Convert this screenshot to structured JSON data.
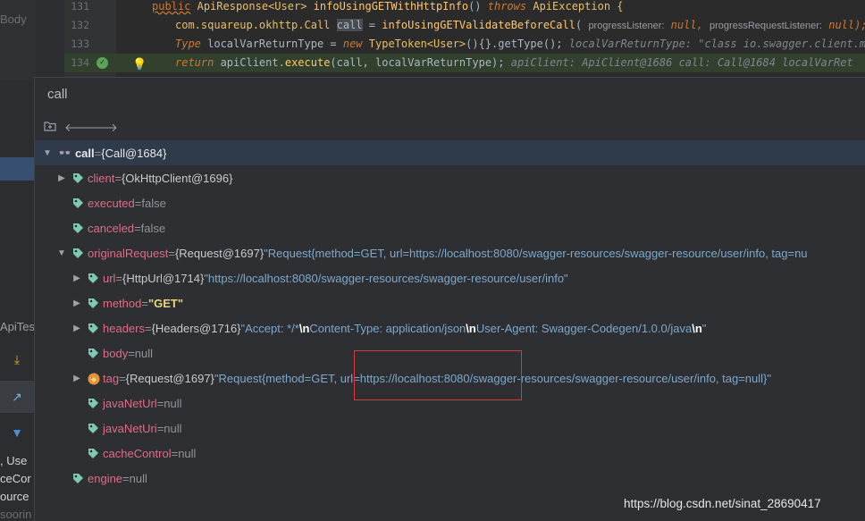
{
  "left_panel": {
    "items": [
      "Body",
      "ApiTes",
      ", Use",
      "ceCor",
      "ource",
      "soorin"
    ],
    "icons": [
      "arrow-down-icon",
      "arrow-up-right-icon",
      "filter-icon"
    ]
  },
  "editor": {
    "lines": [
      {
        "number": "131",
        "keyword_public": "public",
        "type_api": "ApiResponse",
        "type_user": "<User>",
        "method": "infoUsingGETWithHttpInfo",
        "sig_rest": "() ",
        "throws": "throws",
        "exc": "ApiException {"
      },
      {
        "number": "132",
        "prefix": "com.squareup.okhttp.Call ",
        "var": "call",
        "mid": " = ",
        "method": "infoUsingGETValidateBeforeCall",
        "paren": "(",
        "hint1_label": "progressListener:",
        "hint1_val": "null,",
        "hint2_label": "progressRequestListener:",
        "hint2_val": "null);"
      },
      {
        "number": "133",
        "type1": "Type",
        "var": " localVarReturnType = ",
        "new": "new",
        "type2": " TypeToken",
        "generic": "<User>",
        "rest": "(){}.getType();",
        "hint": "localVarReturnType: \"class io.swagger.client.mod"
      },
      {
        "number": "134",
        "return": "return",
        "body": " apiClient.",
        "method": "execute",
        "args": "(call, localVarReturnType);",
        "hint": "apiClient: ApiClient@1686  call: Call@1684  localVarRet"
      }
    ]
  },
  "popup": {
    "title": "call",
    "toolbar_icons": [
      "folder-icon",
      "back-arrow-icon",
      "forward-arrow-icon"
    ],
    "rows": [
      {
        "name": "call",
        "eq": " = ",
        "ref": "{Call@1684}"
      },
      {
        "name": "client",
        "eq": " = ",
        "ref": "{OkHttpClient@1696}"
      },
      {
        "name": "executed",
        "eq": " = ",
        "value": "false"
      },
      {
        "name": "canceled",
        "eq": " = ",
        "value": "false"
      },
      {
        "name": "originalRequest",
        "eq": " = ",
        "ref": "{Request@1697} ",
        "str": "\"Request{method=GET, url=https://localhost:8080/swagger-resources/swagger-resource/user/info, tag=nu"
      },
      {
        "name": "url",
        "eq": " = ",
        "ref": "{HttpUrl@1714} ",
        "str": "\"https://localhost:8080/swagger-resources/swagger-resource/user/info\""
      },
      {
        "name": "method",
        "eq": " = ",
        "str": "\"GET\""
      },
      {
        "name": "headers",
        "eq": " = ",
        "ref": "{Headers@1716} ",
        "s1": "\"Accept: */*",
        "esc1": "\\n",
        "s2": "Content-Type: application/json",
        "esc2": "\\n",
        "s3": "User-Agent: Swagger-Codegen/1.0.0/java",
        "esc3": "\\n",
        "s4": "\""
      },
      {
        "name": "body",
        "eq": " = ",
        "value": "null"
      },
      {
        "name": "tag",
        "eq": " = ",
        "ref": "{Request@1697} ",
        "str": "\"Request{method=GET, url=https://localhost:8080/swagger-resources/swagger-resource/user/info, tag=null}\""
      },
      {
        "name": "javaNetUrl",
        "eq": " = ",
        "value": "null"
      },
      {
        "name": "javaNetUri",
        "eq": " = ",
        "value": "null"
      },
      {
        "name": "cacheControl",
        "eq": " = ",
        "value": "null"
      },
      {
        "name": "engine",
        "eq": " = ",
        "value": "null"
      }
    ]
  },
  "watermark": "https://blog.csdn.net/sinat_28690417",
  "colors": {
    "field_name": "#e06c88",
    "string": "#7ea8c9",
    "highlight_box": "#d13b3b",
    "tag_icon": "#7fc8b4"
  }
}
